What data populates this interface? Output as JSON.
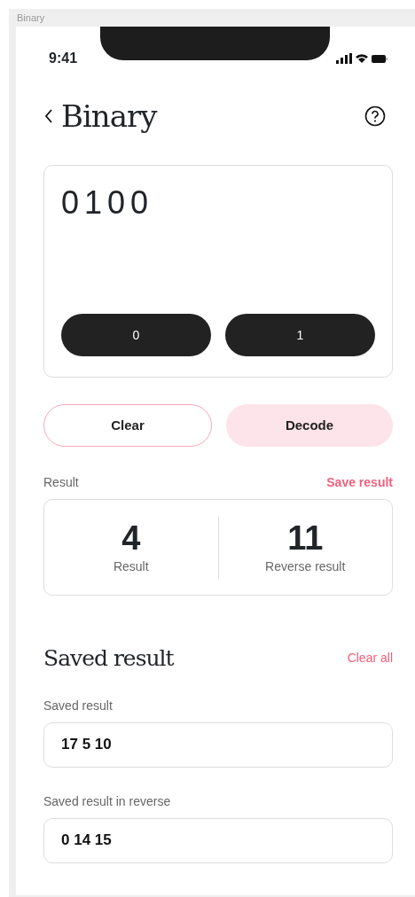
{
  "frame_label": "Binary",
  "status_bar": {
    "time": "9:41"
  },
  "header": {
    "title": "Binary"
  },
  "input": {
    "value": "0100"
  },
  "keypad": [
    {
      "label": "0"
    },
    {
      "label": "1"
    }
  ],
  "actions": [
    {
      "label": "Clear",
      "kind": "outline"
    },
    {
      "label": "Decode",
      "kind": "filled"
    }
  ],
  "result": {
    "label": "Result",
    "action": "Save result",
    "items": [
      {
        "value": "4",
        "caption": "Result"
      },
      {
        "value": "11",
        "caption": "Reverse result"
      }
    ]
  },
  "saved": {
    "title": "Saved result",
    "action": "Clear all",
    "fields": [
      {
        "label": "Saved result",
        "value": "17 5 10"
      },
      {
        "label": "Saved result in reverse",
        "value": "0 14 15"
      }
    ]
  }
}
